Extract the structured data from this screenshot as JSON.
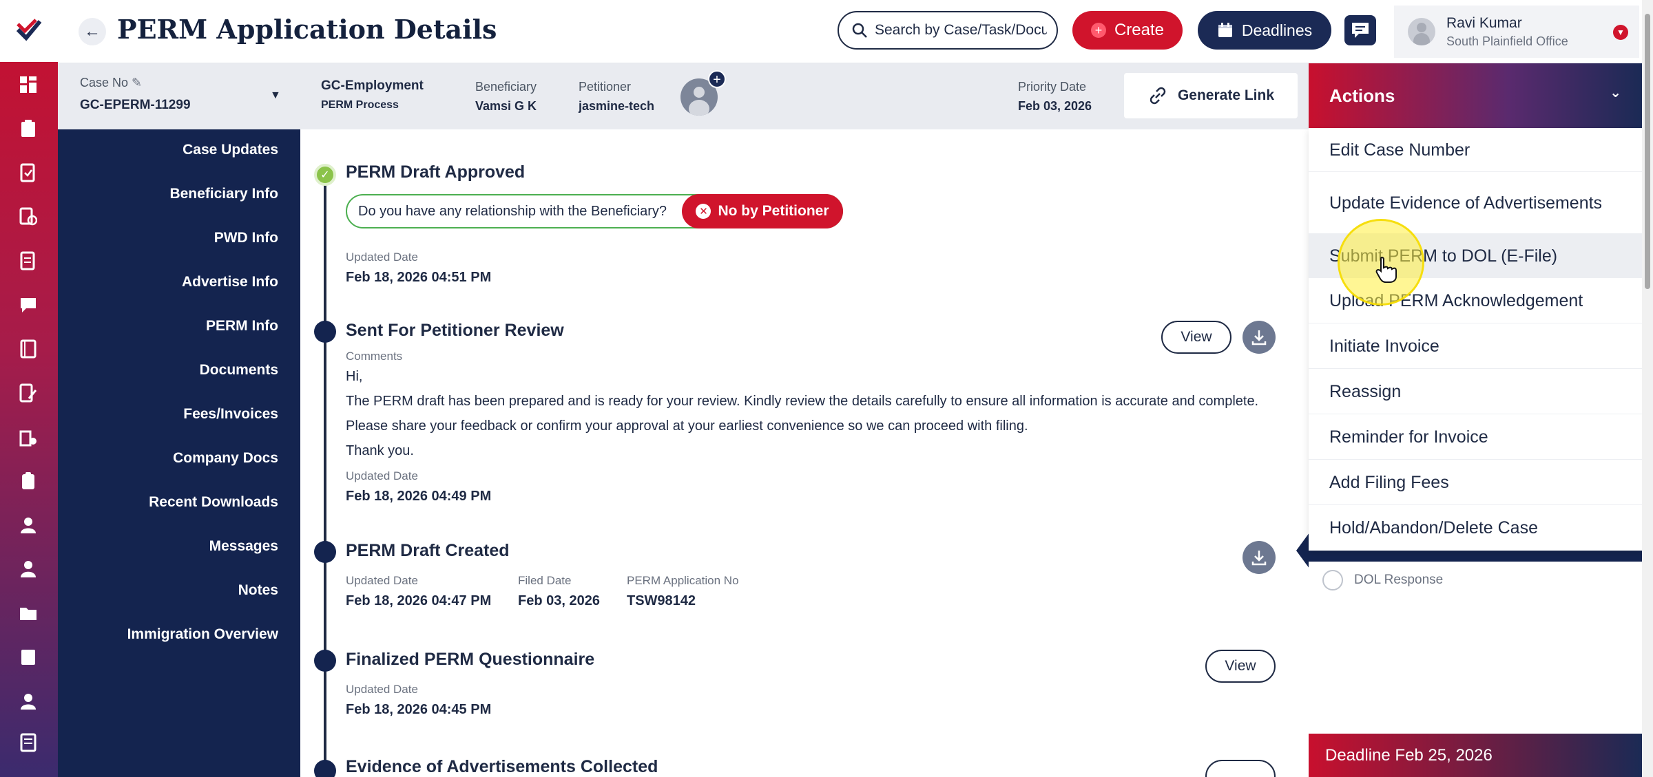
{
  "header": {
    "title": "PERM Application Details",
    "search_placeholder": "Search by Case/Task/Docu",
    "create_label": "Create",
    "deadlines_label": "Deadlines",
    "user_name": "Ravi Kumar",
    "user_office": "South Plainfield Office"
  },
  "case": {
    "case_no_label": "Case No",
    "case_no": "GC-EPERM-11299",
    "case_type": "GC-Employment",
    "process": "PERM Process",
    "beneficiary_label": "Beneficiary",
    "beneficiary": "Vamsi G K",
    "petitioner_label": "Petitioner",
    "petitioner": "jasmine-tech",
    "priority_label": "Priority Date",
    "priority_date": "Feb 03, 2026",
    "generate_link": "Generate Link"
  },
  "sections": [
    "Case Updates",
    "Beneficiary Info",
    "PWD Info",
    "Advertise Info",
    "PERM Info",
    "Documents",
    "Fees/Invoices",
    "Company Docs",
    "Recent Downloads",
    "Messages",
    "Notes",
    "Immigration Overview"
  ],
  "timeline": {
    "e1": {
      "title": "PERM Draft Approved",
      "question": "Do you have any relationship with the Beneficiary?",
      "answer": "No by Petitioner",
      "updated_label": "Updated Date",
      "updated": "Feb 18, 2026 04:51 PM"
    },
    "e2": {
      "title": "Sent For Petitioner Review",
      "comments_label": "Comments",
      "line1": "Hi,",
      "line2": "The PERM draft has been prepared and is ready for your review. Kindly review the details carefully to ensure all information is accurate and complete.",
      "line3": "Please share your feedback or confirm your approval at your earliest convenience so we can proceed with filing.",
      "line4": "Thank you.",
      "updated_label": "Updated Date",
      "updated": "Feb 18, 2026 04:49 PM",
      "view": "View"
    },
    "e3": {
      "title": "PERM Draft Created",
      "updated_label": "Updated Date",
      "updated": "Feb 18, 2026 04:47 PM",
      "filed_label": "Filed Date",
      "filed": "Feb 03, 2026",
      "appno_label": "PERM Application No",
      "appno": "TSW98142"
    },
    "e4": {
      "title": "Finalized PERM Questionnaire",
      "updated_label": "Updated Date",
      "updated": "Feb 18, 2026 04:45 PM",
      "view": "View"
    },
    "e5": {
      "title": "Evidence of Advertisements Collected"
    }
  },
  "actions": {
    "header": "Actions",
    "items": [
      "Edit Case Number",
      "Update Evidence of Advertisements",
      "Submit PERM to DOL (E-File)",
      "Upload PERM Acknowledgement",
      "Initiate Invoice",
      "Reassign",
      "Reminder for Invoice",
      "Add Filing Fees",
      "Hold/Abandon/Delete Case"
    ],
    "dol_response": "DOL Response",
    "deadline": "Deadline Feb 25, 2026"
  },
  "colors": {
    "brand_red": "#d0142c",
    "navy": "#14244f",
    "success_green": "#8bc34a"
  },
  "icons": {
    "rail": [
      "dashboard-icon",
      "clipboard-icon",
      "document-check-icon",
      "calendar-doc-icon",
      "form-icon",
      "chat-icon",
      "book-icon",
      "edit-doc-icon",
      "building-icon",
      "badge-icon",
      "user-icon",
      "user-tie-icon",
      "folder-icon",
      "note-icon",
      "user-group-icon",
      "ledger-icon"
    ]
  }
}
